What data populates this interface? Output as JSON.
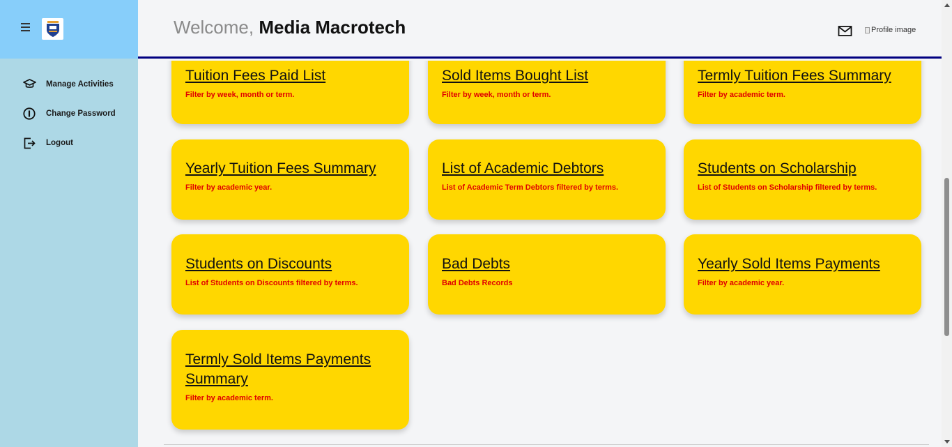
{
  "sidebar": {
    "menu_icon": "hamburger-menu-icon",
    "logo_icon": "school-crest-logo",
    "items": [
      {
        "label": "Manage Activities",
        "icon": "graduation-cap-icon"
      },
      {
        "label": "Change Password",
        "icon": "info-circle-icon"
      },
      {
        "label": "Logout",
        "icon": "logout-arrow-icon"
      }
    ]
  },
  "header": {
    "welcome_prefix": "Welcome, ",
    "user_name": "Media Macrotech",
    "mail_icon": "mail-icon",
    "profile_image_alt": "Profile image"
  },
  "cards": [
    {
      "title": "Tuition Fees Paid List",
      "subtitle": "Filter by week, month or term."
    },
    {
      "title": "Sold Items Bought List",
      "subtitle": "Filter by week, month or term."
    },
    {
      "title": "Termly Tuition Fees Summary",
      "subtitle": "Filter by academic term."
    },
    {
      "title": "Yearly Tuition Fees Summary",
      "subtitle": "Filter by academic year."
    },
    {
      "title": "List of Academic Debtors",
      "subtitle": "List of Academic Term Debtors filtered by terms."
    },
    {
      "title": "Students on Scholarship",
      "subtitle": "List of Students on Scholarship filtered by terms."
    },
    {
      "title": "Students on Discounts",
      "subtitle": "List of Students on Discounts filtered by terms."
    },
    {
      "title": "Bad Debts",
      "subtitle": "Bad Debts Records"
    },
    {
      "title": "Yearly Sold Items Payments",
      "subtitle": "Filter by academic year."
    },
    {
      "title": "Termly Sold Items Payments Summary",
      "subtitle": "Filter by academic term."
    }
  ],
  "colors": {
    "sidebar_bg": "#add8e6",
    "sidebar_top_bg": "#87cefa",
    "card_bg": "#ffd700",
    "card_subtitle": "#e00000",
    "header_border": "#000080"
  }
}
